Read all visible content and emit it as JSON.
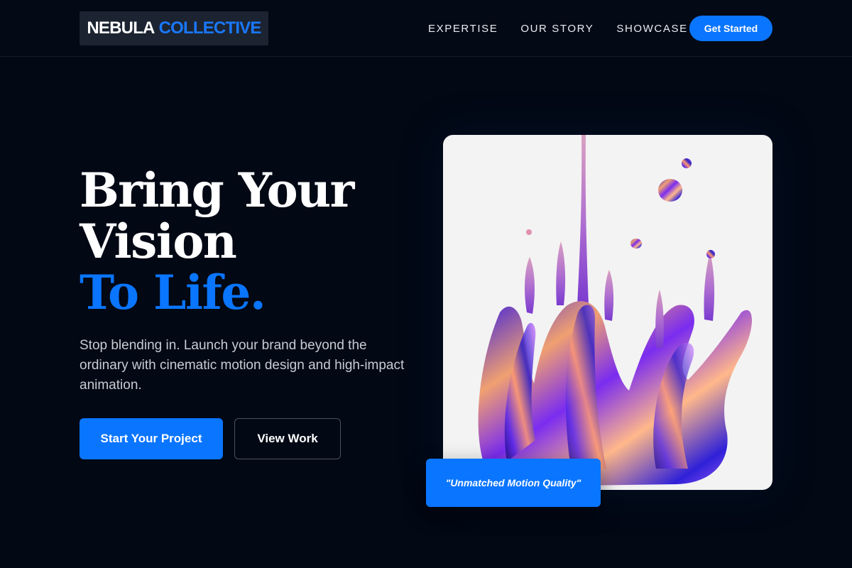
{
  "brand": {
    "name_primary": "NEBULA",
    "name_accent": "COLLECTIVE",
    "accent_color": "#0a75ff"
  },
  "nav": {
    "items": [
      {
        "label": "EXPERTISE"
      },
      {
        "label": "OUR STORY"
      },
      {
        "label": "SHOWCASE"
      }
    ],
    "cta_label": "Get Started"
  },
  "hero": {
    "title_line1": "Bring Your",
    "title_line2": "Vision",
    "title_line3": "To Life.",
    "subtitle": "Stop blending in. Launch your brand beyond the ordinary with cinematic motion design and high-impact animation.",
    "primary_button": "Start Your Project",
    "secondary_button": "View Work"
  },
  "showcase": {
    "image_subject": "iridescent-liquid-splash",
    "quote": "\"Unmatched Motion Quality\""
  }
}
